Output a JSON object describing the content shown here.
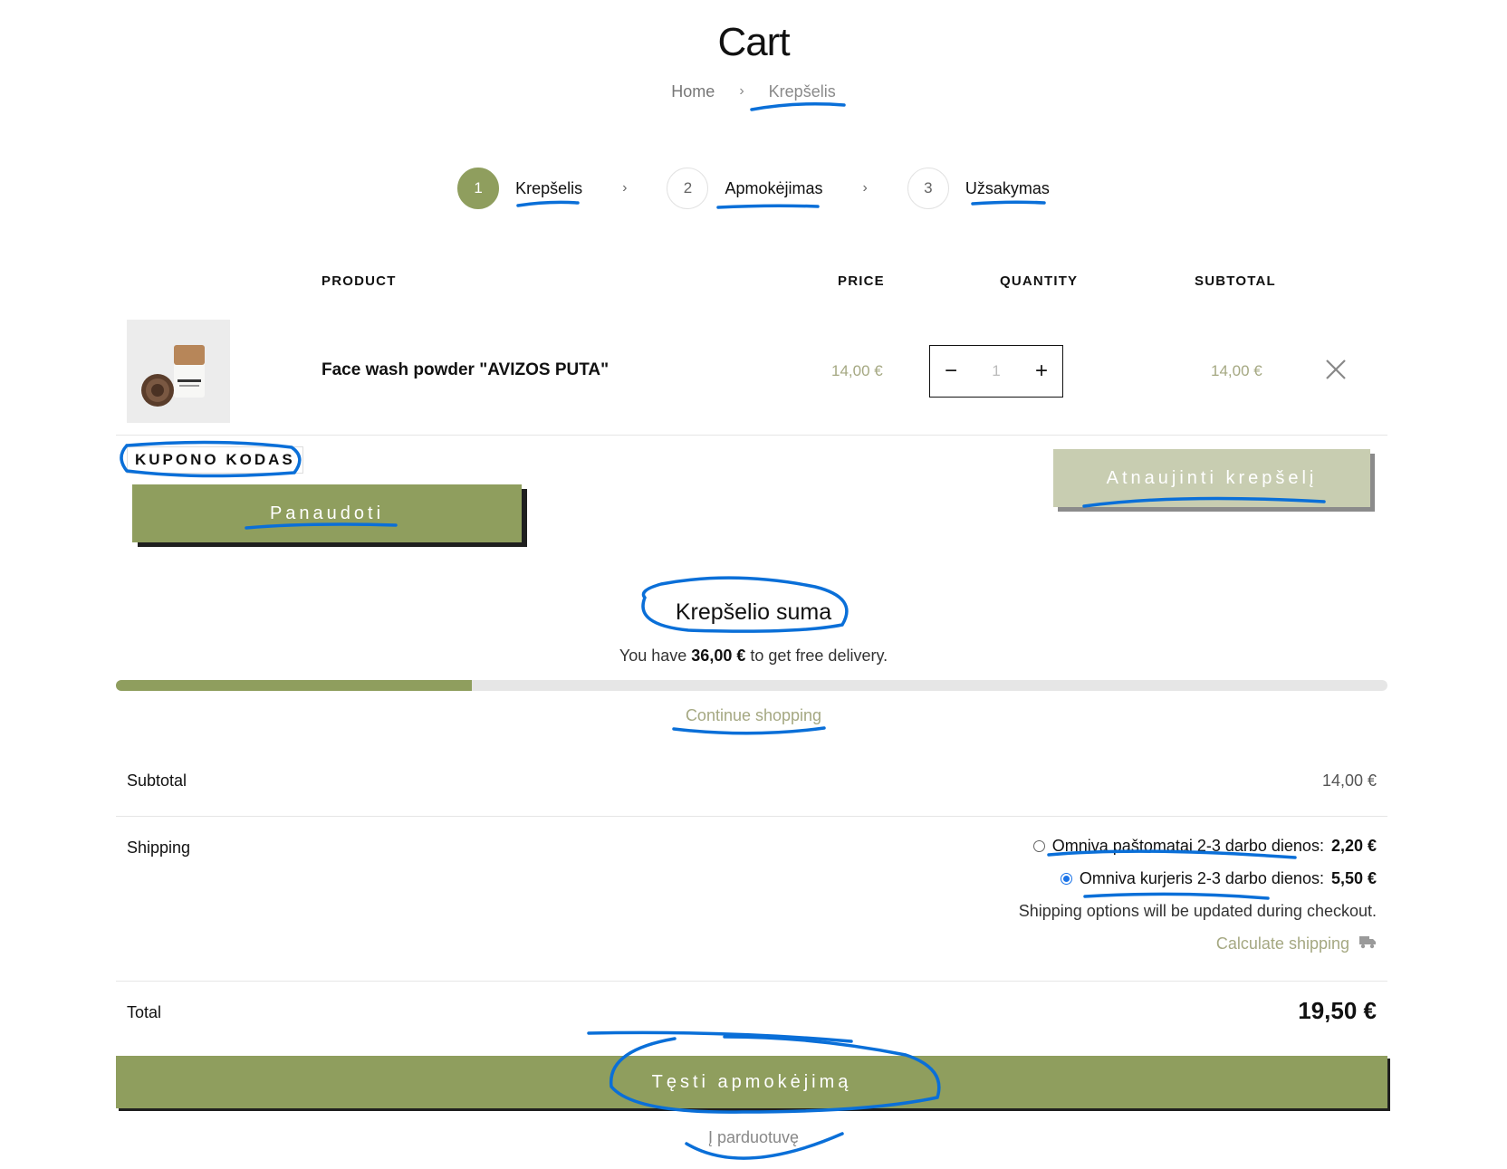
{
  "page": {
    "title": "Cart"
  },
  "breadcrumb": {
    "home": "Home",
    "separator": "›",
    "current": "Krepšelis"
  },
  "steps": [
    {
      "num": "1",
      "label": "Krepšelis",
      "active": true
    },
    {
      "num": "2",
      "label": "Apmokėjimas",
      "active": false
    },
    {
      "num": "3",
      "label": "Užsakymas",
      "active": false
    }
  ],
  "steps_separator": "›",
  "table": {
    "headers": {
      "product": "PRODUCT",
      "price": "PRICE",
      "quantity": "QUANTITY",
      "subtotal": "SUBTOTAL"
    },
    "item": {
      "name": "Face wash powder \"AVIZOS PUTA\"",
      "price": "14,00 €",
      "quantity": "1",
      "minus": "−",
      "plus": "+",
      "subtotal": "14,00 €",
      "image_label": "AVIZOS PUTA"
    }
  },
  "coupon": {
    "label": "KUPONO KODAS",
    "apply_button": "Panaudoti"
  },
  "update_button": "Atnaujinti krepšelį",
  "totals": {
    "title": "Krepšelio suma",
    "free_delivery_prefix": "You have",
    "free_delivery_amount": "36,00 €",
    "free_delivery_suffix": "to get free delivery.",
    "free_delivery_progress": 0.28,
    "continue_shopping": "Continue shopping",
    "subtotal_label": "Subtotal",
    "subtotal_value": "14,00 €",
    "shipping_label": "Shipping",
    "shipping_options": [
      {
        "name": "Omniva paštomatai 2-3 darbo dienos:",
        "price": "2,20 €",
        "selected": false
      },
      {
        "name": "Omniva kurjeris 2-3 darbo dienos:",
        "price": "5,50 €",
        "selected": true
      }
    ],
    "shipping_note": "Shipping options will be updated during checkout.",
    "calculate_shipping": "Calculate shipping",
    "total_label": "Total",
    "total_value": "19,50 €"
  },
  "checkout_button": "Tęsti apmokėjimą",
  "to_shop_link": "Į parduotuvę",
  "colors": {
    "accent": "#8f9e5e",
    "accent_light": "#c8cdb1",
    "price_text": "#a5a882",
    "annotation": "#0a6fd8"
  },
  "icons": {
    "remove": "close-icon",
    "calculate_shipping": "truck-icon"
  }
}
